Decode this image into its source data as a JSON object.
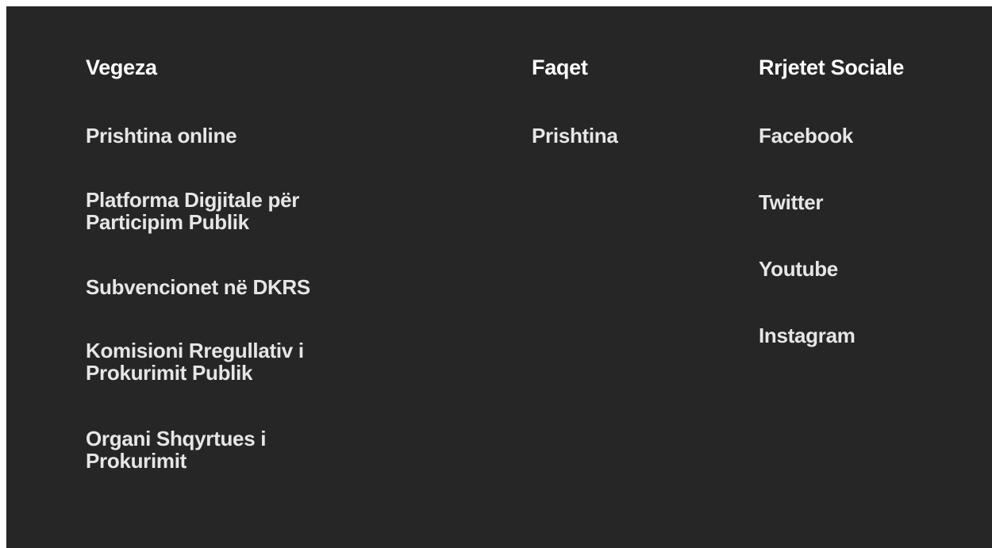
{
  "footer": {
    "columns": [
      {
        "title": "Vegeza",
        "links": [
          "Prishtina online",
          "Platforma Digjitale për Participim Publik",
          "Subvencionet në DKRS",
          "Komisioni Rregullativ i Prokurimit Publik",
          "Organi Shqyrtues i Prokurimit"
        ]
      },
      {
        "title": "Faqet",
        "links": [
          "Prishtina"
        ]
      },
      {
        "title": "Rrjetet Sociale",
        "links": [
          "Facebook",
          "Twitter",
          "Youtube",
          "Instagram"
        ]
      }
    ]
  },
  "colors": {
    "background": "#262626",
    "text": "#e6e6e6",
    "title": "#ffffff"
  }
}
